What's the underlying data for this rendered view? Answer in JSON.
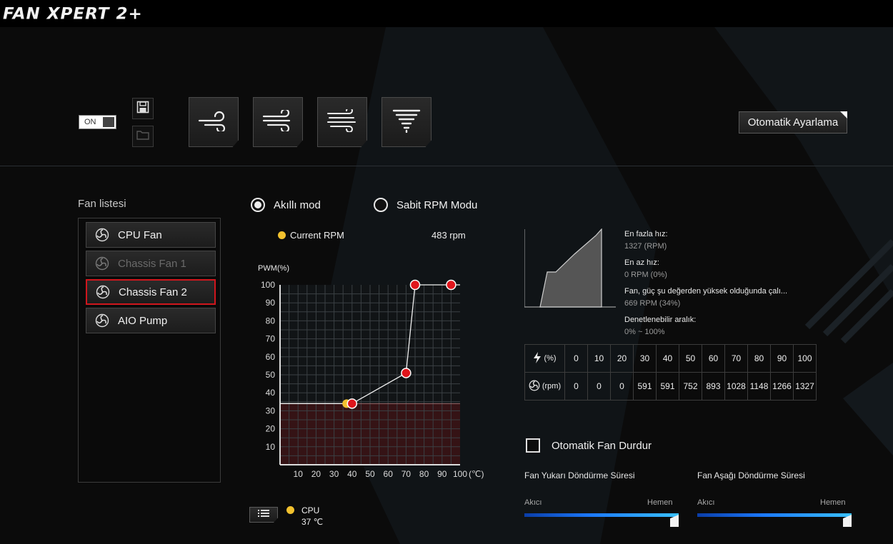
{
  "app": {
    "title": "FAN XPERT 2+"
  },
  "toolbar": {
    "power_toggle": "ON",
    "save_icon": "floppy-disk-icon",
    "open_icon": "folder-icon",
    "profiles": [
      "silent-profile-icon",
      "standard-profile-icon",
      "turbo-profile-icon",
      "full-speed-profile-icon"
    ],
    "auto_tune_label": "Otomatik Ayarlama"
  },
  "fan_list": {
    "title": "Fan listesi",
    "items": [
      {
        "label": "CPU Fan",
        "state": "normal"
      },
      {
        "label": "Chassis Fan 1",
        "state": "disabled"
      },
      {
        "label": "Chassis Fan 2",
        "state": "selected"
      },
      {
        "label": "AIO Pump",
        "state": "normal"
      }
    ]
  },
  "modes": {
    "smart": "Akıllı mod",
    "fixed": "Sabit RPM Modu",
    "selected": "smart"
  },
  "current": {
    "label": "Current RPM",
    "value": "483 rpm",
    "sensor_label": "CPU",
    "sensor_value": "37 ℃"
  },
  "chart_data": {
    "type": "line",
    "ylabel": "PWM(%)",
    "xlabel": "(℃)",
    "x_ticks": [
      "10",
      "20",
      "30",
      "40",
      "50",
      "60",
      "70",
      "80",
      "90",
      "100"
    ],
    "y_ticks": [
      "10",
      "20",
      "30",
      "40",
      "50",
      "60",
      "70",
      "80",
      "90",
      "100"
    ],
    "xlim": [
      0,
      100
    ],
    "ylim": [
      0,
      100
    ],
    "grid": true,
    "curve_points": [
      {
        "x": 40,
        "y": 34
      },
      {
        "x": 70,
        "y": 51
      },
      {
        "x": 75,
        "y": 100
      },
      {
        "x": 95,
        "y": 100
      }
    ],
    "current_point": {
      "x": 37,
      "y": 34
    },
    "threshold_pwm": 34,
    "colors": {
      "point": "#e0151c",
      "current": "#f2c12e",
      "threshold_fill": "#3a1315"
    }
  },
  "fan_info": {
    "max_label": "En fazla hız:",
    "max_value": "1327 (RPM)",
    "min_label": "En az hız:",
    "min_value": "0 RPM (0%)",
    "start_label": "Fan, güç şu değerden yüksek olduğunda çalı...",
    "start_value": "669 RPM (34%)",
    "range_label": "Denetlenebilir aralık:",
    "range_value": "0% ~ 100%"
  },
  "rpm_table": {
    "pwm_header": "(%)",
    "rpm_header": "(rpm)",
    "pwm": [
      "0",
      "10",
      "20",
      "30",
      "40",
      "50",
      "60",
      "70",
      "80",
      "90",
      "100"
    ],
    "rpm": [
      "0",
      "0",
      "0",
      "591",
      "591",
      "752",
      "893",
      "1028",
      "1148",
      "1266",
      "1327"
    ]
  },
  "auto_stop": {
    "label": "Otomatik Fan Durdur",
    "checked": false
  },
  "spin_up": {
    "title": "Fan Yukarı Döndürme Süresi",
    "left": "Akıcı",
    "right": "Hemen",
    "value": 1.0
  },
  "spin_down": {
    "title": "Fan Aşağı Döndürme Süresi",
    "left": "Akıcı",
    "right": "Hemen",
    "value": 1.0
  }
}
